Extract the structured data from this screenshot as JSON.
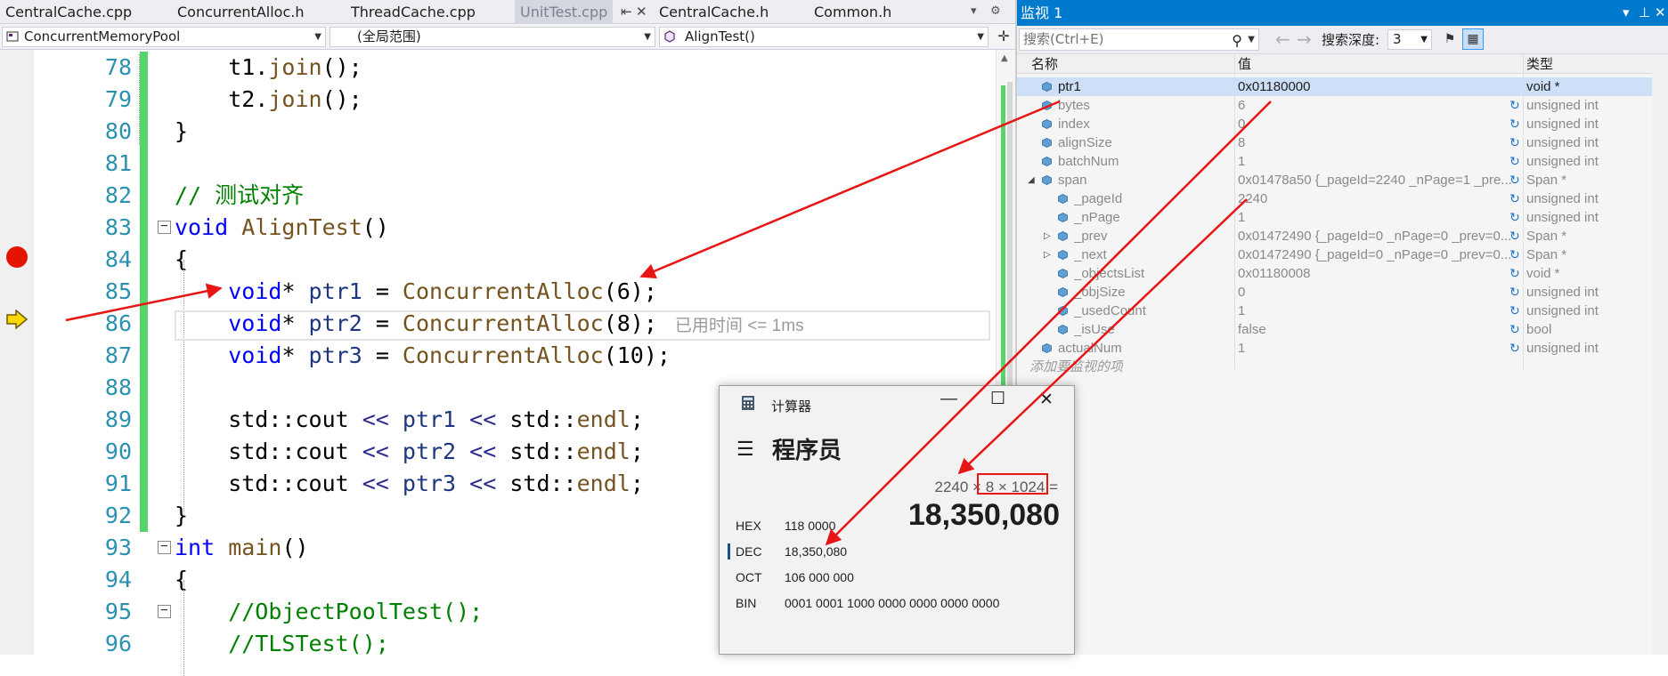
{
  "editor": {
    "tabs": [
      {
        "label": "CentralCache.cpp"
      },
      {
        "label": "ConcurrentAlloc.h"
      },
      {
        "label": "ThreadCache.cpp"
      },
      {
        "label": "UnitTest.cpp"
      },
      {
        "label": "CentralCache.h"
      },
      {
        "label": "Common.h"
      }
    ],
    "nav": {
      "project": "ConcurrentMemoryPool",
      "scope": "(全局范围)",
      "member": "AlignTest()"
    },
    "lines": [
      {
        "n": "78",
        "parts": [
          {
            "t": "    t1.",
            "c": ""
          },
          {
            "t": "join",
            "c": "fn"
          },
          {
            "t": "();",
            "c": ""
          }
        ]
      },
      {
        "n": "79",
        "parts": [
          {
            "t": "    t2.",
            "c": ""
          },
          {
            "t": "join",
            "c": "fn"
          },
          {
            "t": "();",
            "c": ""
          }
        ]
      },
      {
        "n": "80",
        "parts": [
          {
            "t": "}",
            "c": ""
          }
        ]
      },
      {
        "n": "81",
        "parts": []
      },
      {
        "n": "82",
        "parts": [
          {
            "t": "// 测试对齐",
            "c": "cm"
          }
        ]
      },
      {
        "n": "83",
        "parts": [
          {
            "t": "void",
            "c": "kw"
          },
          {
            "t": " ",
            "c": ""
          },
          {
            "t": "AlignTest",
            "c": "fn"
          },
          {
            "t": "()",
            "c": ""
          }
        ]
      },
      {
        "n": "84",
        "parts": [
          {
            "t": "{",
            "c": ""
          }
        ]
      },
      {
        "n": "85",
        "parts": [
          {
            "t": "    ",
            "c": ""
          },
          {
            "t": "void",
            "c": "kw"
          },
          {
            "t": "* ",
            "c": ""
          },
          {
            "t": "ptr1",
            "c": "vr"
          },
          {
            "t": " = ",
            "c": ""
          },
          {
            "t": "ConcurrentAlloc",
            "c": "fn"
          },
          {
            "t": "(6);",
            "c": ""
          }
        ]
      },
      {
        "n": "86",
        "parts": [
          {
            "t": "    ",
            "c": ""
          },
          {
            "t": "void",
            "c": "kw"
          },
          {
            "t": "* ",
            "c": ""
          },
          {
            "t": "ptr2",
            "c": "vr"
          },
          {
            "t": " = ",
            "c": ""
          },
          {
            "t": "ConcurrentAlloc",
            "c": "fn"
          },
          {
            "t": "(8);",
            "c": ""
          }
        ],
        "hint": "已用时间 <= 1ms"
      },
      {
        "n": "87",
        "parts": [
          {
            "t": "    ",
            "c": ""
          },
          {
            "t": "void",
            "c": "kw"
          },
          {
            "t": "* ",
            "c": ""
          },
          {
            "t": "ptr3",
            "c": "vr"
          },
          {
            "t": " = ",
            "c": ""
          },
          {
            "t": "ConcurrentAlloc",
            "c": "fn"
          },
          {
            "t": "(10);",
            "c": ""
          }
        ]
      },
      {
        "n": "88",
        "parts": []
      },
      {
        "n": "89",
        "parts": [
          {
            "t": "    std::",
            "c": ""
          },
          {
            "t": "cout",
            "c": ""
          },
          {
            "t": " << ",
            "c": "ty"
          },
          {
            "t": "ptr1",
            "c": "vr"
          },
          {
            "t": " << ",
            "c": "ty"
          },
          {
            "t": "std::",
            "c": ""
          },
          {
            "t": "endl",
            "c": "fn"
          },
          {
            "t": ";",
            "c": ""
          }
        ]
      },
      {
        "n": "90",
        "parts": [
          {
            "t": "    std::",
            "c": ""
          },
          {
            "t": "cout",
            "c": ""
          },
          {
            "t": " << ",
            "c": "ty"
          },
          {
            "t": "ptr2",
            "c": "vr"
          },
          {
            "t": " << ",
            "c": "ty"
          },
          {
            "t": "std::",
            "c": ""
          },
          {
            "t": "endl",
            "c": "fn"
          },
          {
            "t": ";",
            "c": ""
          }
        ]
      },
      {
        "n": "91",
        "parts": [
          {
            "t": "    std::",
            "c": ""
          },
          {
            "t": "cout",
            "c": ""
          },
          {
            "t": " << ",
            "c": "ty"
          },
          {
            "t": "ptr3",
            "c": "vr"
          },
          {
            "t": " << ",
            "c": "ty"
          },
          {
            "t": "std::",
            "c": ""
          },
          {
            "t": "endl",
            "c": "fn"
          },
          {
            "t": ";",
            "c": ""
          }
        ]
      },
      {
        "n": "92",
        "parts": [
          {
            "t": "}",
            "c": ""
          }
        ]
      },
      {
        "n": "93",
        "parts": [
          {
            "t": "int",
            "c": "kw"
          },
          {
            "t": " ",
            "c": ""
          },
          {
            "t": "main",
            "c": "fn"
          },
          {
            "t": "()",
            "c": ""
          }
        ]
      },
      {
        "n": "94",
        "parts": [
          {
            "t": "{",
            "c": ""
          }
        ]
      },
      {
        "n": "95",
        "parts": [
          {
            "t": "    //ObjectPoolTest();",
            "c": "cm"
          }
        ]
      },
      {
        "n": "96",
        "parts": [
          {
            "t": "    //TLSTest();",
            "c": "cm"
          }
        ]
      }
    ]
  },
  "watch": {
    "title": "监视 1",
    "search_placeholder": "搜索(Ctrl+E)",
    "depth_label": "搜索深度:",
    "depth_value": "3",
    "columns": {
      "name": "名称",
      "value": "值",
      "type": "类型"
    },
    "rows": [
      {
        "name": "ptr1",
        "value": "0x01180000",
        "type": "void *",
        "indent": 0,
        "expand": "",
        "refresh": false,
        "selected": true
      },
      {
        "name": "bytes",
        "value": "6",
        "type": "unsigned int",
        "indent": 0,
        "expand": "",
        "refresh": true
      },
      {
        "name": "index",
        "value": "0",
        "type": "unsigned int",
        "indent": 0,
        "expand": "",
        "refresh": true
      },
      {
        "name": "alignSize",
        "value": "8",
        "type": "unsigned int",
        "indent": 0,
        "expand": "",
        "refresh": true
      },
      {
        "name": "batchNum",
        "value": "1",
        "type": "unsigned int",
        "indent": 0,
        "expand": "",
        "refresh": true
      },
      {
        "name": "span",
        "value": "0x01478a50 {_pageId=2240 _nPage=1 _pre...",
        "type": "Span *",
        "indent": 0,
        "expand": "down",
        "refresh": true
      },
      {
        "name": "_pageId",
        "value": "2240",
        "type": "unsigned int",
        "indent": 1,
        "expand": "",
        "refresh": true
      },
      {
        "name": "_nPage",
        "value": "1",
        "type": "unsigned int",
        "indent": 1,
        "expand": "",
        "refresh": true
      },
      {
        "name": "_prev",
        "value": "0x01472490 {_pageId=0 _nPage=0 _prev=0...",
        "type": "Span *",
        "indent": 1,
        "expand": "right",
        "refresh": true
      },
      {
        "name": "_next",
        "value": "0x01472490 {_pageId=0 _nPage=0 _prev=0...",
        "type": "Span *",
        "indent": 1,
        "expand": "right",
        "refresh": true
      },
      {
        "name": "_objectsList",
        "value": "0x01180008",
        "type": "void *",
        "indent": 1,
        "expand": "",
        "refresh": true
      },
      {
        "name": "_objSize",
        "value": "0",
        "type": "unsigned int",
        "indent": 1,
        "expand": "",
        "refresh": true
      },
      {
        "name": "_usedCount",
        "value": "1",
        "type": "unsigned int",
        "indent": 1,
        "expand": "",
        "refresh": true
      },
      {
        "name": "_isUse",
        "value": "false",
        "type": "bool",
        "indent": 1,
        "expand": "",
        "refresh": true
      },
      {
        "name": "actualNum",
        "value": "1",
        "type": "unsigned int",
        "indent": 0,
        "expand": "",
        "refresh": true
      }
    ],
    "add_placeholder": "添加要监视的项"
  },
  "calculator": {
    "title": "计算器",
    "mode": "程序员",
    "expression": "2240 × 8 × 1024 =",
    "result": "18,350,080",
    "radix": [
      {
        "label": "HEX",
        "value": "118 0000"
      },
      {
        "label": "DEC",
        "value": "18,350,080",
        "active": true
      },
      {
        "label": "OCT",
        "value": "106 000 000"
      },
      {
        "label": "BIN",
        "value": "0001 0001 1000 0000 0000 0000 0000"
      }
    ]
  },
  "colors": {
    "accent": "#007acc",
    "breakpoint": "#e51400",
    "annotation_arrow": "#e81515",
    "change_bar": "#57d46a"
  }
}
